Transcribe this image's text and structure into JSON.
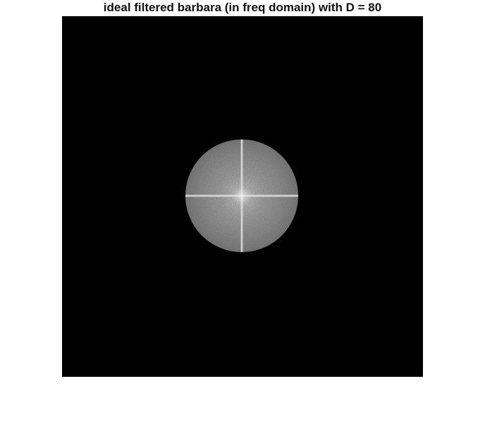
{
  "figure": {
    "title": "ideal filtered barbara (in freq domain) with D = 80"
  }
}
